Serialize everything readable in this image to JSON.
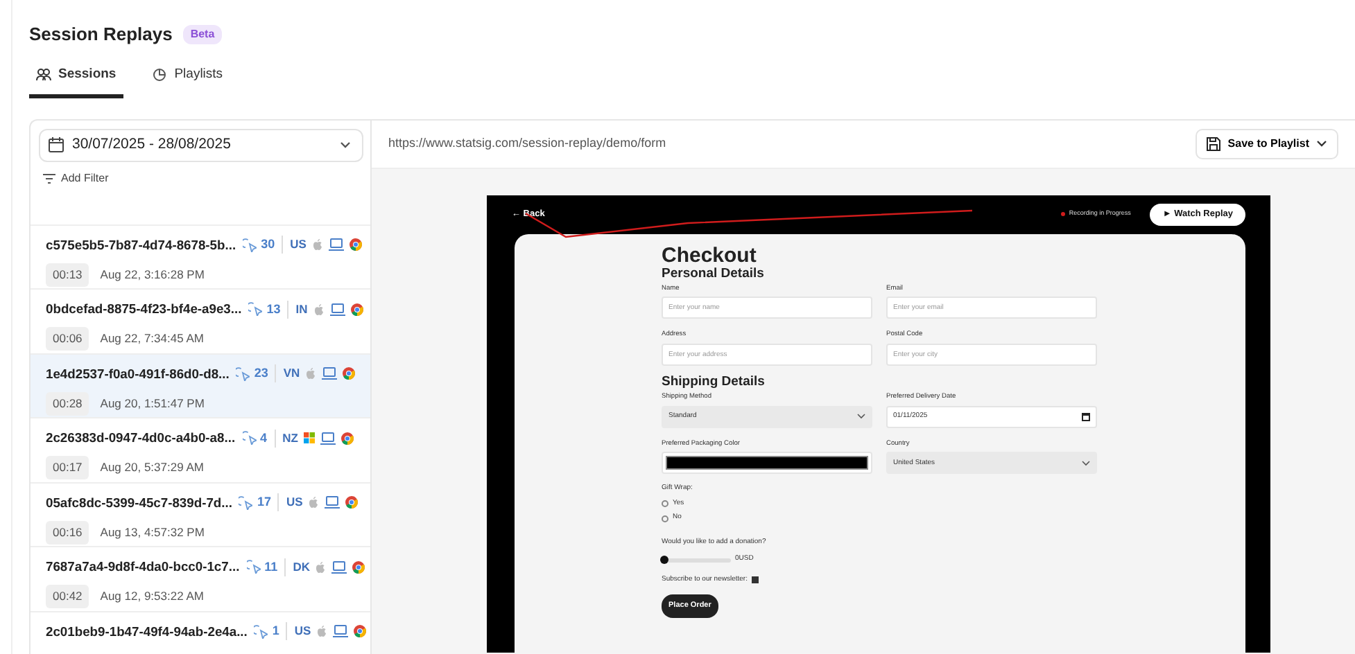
{
  "header": {
    "title": "Session Replays",
    "badge": "Beta"
  },
  "tabs": [
    {
      "label": "Sessions",
      "selected": true
    },
    {
      "label": "Playlists",
      "selected": false
    }
  ],
  "filters": {
    "date_range": "30/07/2025 - 28/08/2025",
    "add_filter": "Add Filter"
  },
  "sessions": [
    {
      "id": "c575e5b5-7b87-4d74-8678-5b...",
      "clicks": "30",
      "country": "US",
      "kind": "apple",
      "duration": "00:13",
      "time": "Aug 22, 3:16:28 PM",
      "selected": false
    },
    {
      "id": "0bdcefad-8875-4f23-bf4e-a9e3...",
      "clicks": "13",
      "country": "IN",
      "kind": "apple",
      "duration": "00:06",
      "time": "Aug 22, 7:34:45 AM",
      "selected": false
    },
    {
      "id": "1e4d2537-f0a0-491f-86d0-d8...",
      "clicks": "23",
      "country": "VN",
      "kind": "apple",
      "duration": "00:28",
      "time": "Aug 20, 1:51:47 PM",
      "selected": true
    },
    {
      "id": "2c26383d-0947-4d0c-a4b0-a8...",
      "clicks": "4",
      "country": "NZ",
      "kind": "windows",
      "duration": "00:17",
      "time": "Aug 20, 5:37:29 AM",
      "selected": false
    },
    {
      "id": "05afc8dc-5399-45c7-839d-7d...",
      "clicks": "17",
      "country": "US",
      "kind": "apple",
      "duration": "00:16",
      "time": "Aug 13, 4:57:32 PM",
      "selected": false
    },
    {
      "id": "7687a7a4-9d8f-4da0-bcc0-1c7...",
      "clicks": "11",
      "country": "DK",
      "kind": "apple",
      "duration": "00:42",
      "time": "Aug 12, 9:53:22 AM",
      "selected": false
    },
    {
      "id": "2c01beb9-1b47-49f4-94ab-2e4a...",
      "clicks": "1",
      "country": "US",
      "kind": "apple",
      "selected": false
    }
  ],
  "replay": {
    "url": "https://www.statsig.com/session-replay/demo/form",
    "save_button": "Save to Playlist",
    "recording": {
      "back": "← Back",
      "status": "Recording in Progress",
      "watch_button": "► Watch Replay",
      "form": {
        "title": "Checkout",
        "sections": [
          {
            "title": "Personal Details",
            "fields": [
              {
                "kind": "text",
                "label": "Name",
                "placeholder": "Enter your name"
              },
              {
                "kind": "text",
                "label": "Email",
                "placeholder": "Enter your email"
              },
              {
                "kind": "text",
                "label": "Address",
                "placeholder": "Enter your address"
              },
              {
                "kind": "text",
                "label": "Postal Code",
                "placeholder": "Enter your city"
              }
            ]
          },
          {
            "title": "Shipping Details",
            "fields": [
              {
                "kind": "select",
                "label": "Shipping Method",
                "value": "Standard"
              },
              {
                "kind": "date",
                "label": "Preferred Delivery Date",
                "value": "01/11/2025"
              },
              {
                "kind": "color",
                "label": "Preferred Packaging Color",
                "color": "#000000"
              },
              {
                "kind": "select",
                "label": "Country",
                "value": "United States"
              }
            ]
          }
        ],
        "gift_wrap": {
          "label": "Gift Wrap:",
          "options": [
            {
              "label": "Yes",
              "selected": false
            },
            {
              "label": "No",
              "selected": false
            }
          ]
        },
        "donation": {
          "label": "Would you like to add a donation?",
          "level": 0,
          "reading": "0USD"
        },
        "newsletter": {
          "label": "Subscribe to our newsletter:",
          "checked": true
        },
        "submit": "Place Order"
      }
    }
  }
}
